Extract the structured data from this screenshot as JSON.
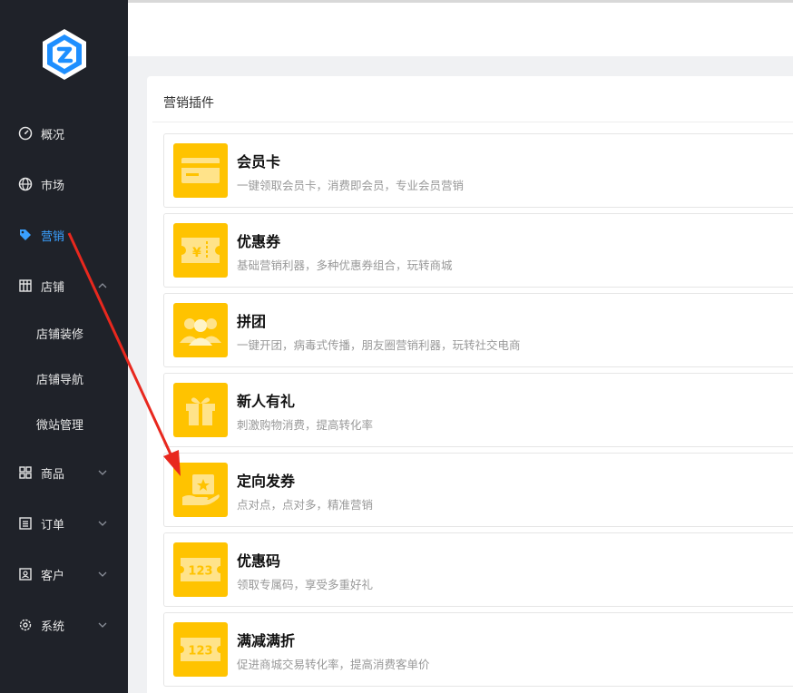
{
  "sidebar": {
    "items": [
      {
        "label": "概况",
        "icon": "gauge-icon"
      },
      {
        "label": "市场",
        "icon": "globe-icon"
      },
      {
        "label": "营销",
        "icon": "tag-icon"
      },
      {
        "label": "店铺",
        "icon": "store-icon"
      },
      {
        "label": "商品",
        "icon": "grid-icon"
      },
      {
        "label": "订单",
        "icon": "list-icon"
      },
      {
        "label": "客户",
        "icon": "contact-icon"
      },
      {
        "label": "系统",
        "icon": "gear-icon"
      }
    ],
    "store_subitems": [
      "店铺装修",
      "店铺导航",
      "微站管理"
    ],
    "active_color": "#3aa0ff"
  },
  "panel": {
    "title": "营销插件"
  },
  "plugins": [
    {
      "title": "会员卡",
      "desc": "一键领取会员卡，消费即会员，专业会员营销",
      "icon": "membership-card-icon"
    },
    {
      "title": "优惠券",
      "desc": "基础营销利器，多种优惠券组合，玩转商城",
      "icon": "coupon-icon"
    },
    {
      "title": "拼团",
      "desc": "一键开团，病毒式传播，朋友圈营销利器，玩转社交电商",
      "icon": "group-buy-icon"
    },
    {
      "title": "新人有礼",
      "desc": "刺激购物消费，提高转化率",
      "icon": "gift-icon"
    },
    {
      "title": "定向发券",
      "desc": "点对点，点对多，精准营销",
      "icon": "targeted-coupon-icon"
    },
    {
      "title": "优惠码",
      "desc": "领取专属码，享受多重好礼",
      "icon": "promo-code-icon",
      "badge": "123"
    },
    {
      "title": "满减满折",
      "desc": "促进商城交易转化率，提高消费客单价",
      "icon": "discount-icon",
      "badge": "123"
    }
  ],
  "colors": {
    "sidebar_bg": "#1f2229",
    "accent_yellow": "#ffc300",
    "arrow_red": "#e8281e"
  }
}
